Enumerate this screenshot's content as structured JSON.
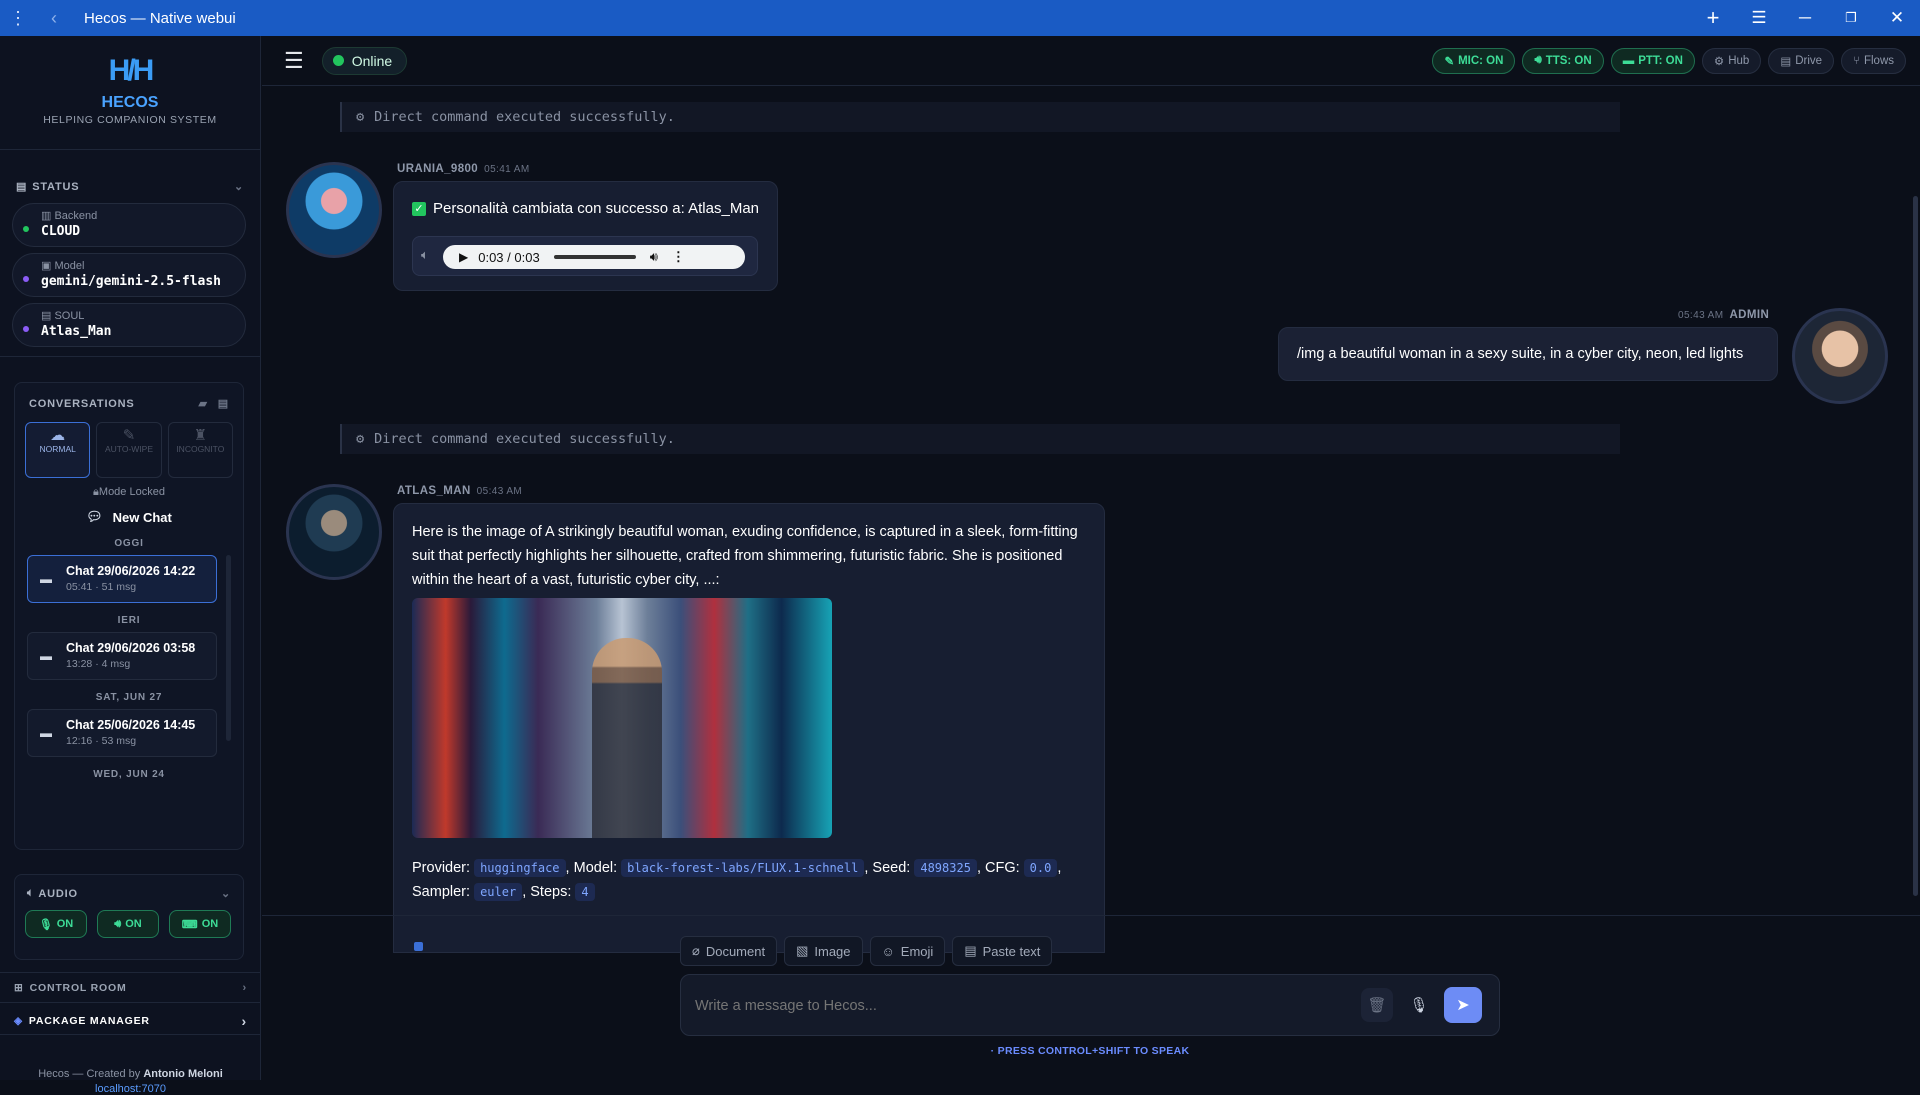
{
  "window": {
    "title": "Hecos — Native webui"
  },
  "brand": {
    "name": "HECOS",
    "subtitle": "HELPING COMPANION SYSTEM"
  },
  "status": {
    "heading": "STATUS",
    "items": [
      {
        "label": "Backend",
        "value": "CLOUD",
        "color": "#22c55e"
      },
      {
        "label": "Model",
        "value": "gemini/gemini-2.5-flash",
        "color": "#8b5cf6"
      },
      {
        "label": "SOUL",
        "value": "Atlas_Man",
        "color": "#8b5cf6"
      }
    ]
  },
  "conversations": {
    "heading": "CONVERSATIONS",
    "modes": [
      {
        "label": "NORMAL",
        "icon": "cloud-icon"
      },
      {
        "label": "AUTO-WIPE",
        "icon": "broom-icon"
      },
      {
        "label": "INCOGNITO",
        "icon": "incognito-icon"
      }
    ],
    "mode_locked": "Mode Locked",
    "new_chat": "New Chat",
    "groups": [
      {
        "day": "OGGI",
        "chats": [
          {
            "title": "Chat 29/06/2026 14:22",
            "sub": "05:41 · 51 msg"
          }
        ]
      },
      {
        "day": "IERI",
        "chats": [
          {
            "title": "Chat 29/06/2026 03:58",
            "sub": "13:28 · 4 msg"
          }
        ]
      },
      {
        "day": "SAT, JUN 27",
        "chats": [
          {
            "title": "Chat 25/06/2026 14:45",
            "sub": "12:16 · 53 msg"
          }
        ]
      },
      {
        "day": "WED, JUN 24",
        "chats": []
      }
    ]
  },
  "audio": {
    "heading": "AUDIO",
    "mic": "ON",
    "tts": "ON",
    "ptt": "ON"
  },
  "nav": {
    "control_room": "CONTROL ROOM",
    "package_manager": "PACKAGE MANAGER"
  },
  "footer": {
    "text": "Hecos — Created by",
    "author": "Antonio Meloni",
    "host": "localhost:7070"
  },
  "topbar": {
    "online": "Online",
    "pills": [
      "MIC: ON",
      "TTS: ON",
      "PTT: ON",
      "Hub",
      "Drive",
      "Flows"
    ]
  },
  "messages": {
    "sys1": "Direct command executed successfully.",
    "sys2": "Direct command executed successfully.",
    "m1": {
      "sender": "URANIA_9800",
      "time": "05:41 AM",
      "text": "Personalità cambiata con successo a: Atlas_Man",
      "audio_time": "0:03 / 0:03"
    },
    "m2": {
      "sender": "ADMIN",
      "time": "05:43 AM",
      "text": "/img a beautiful woman in a sexy suite, in a cyber city, neon, led lights"
    },
    "m3": {
      "sender": "ATLAS_MAN",
      "time": "05:43 AM",
      "text": "Here is the image of A strikingly beautiful woman, exuding confidence, is captured in a sleek, form-fitting suit that perfectly highlights her silhouette, crafted from shimmering, futuristic fabric. She is positioned within the heart of a vast, futuristic cyber city, ...:",
      "provider_label": "Provider:",
      "provider": "huggingface",
      "model_label": "Model:",
      "model": "black-forest-labs/FLUX.1-schnell",
      "seed_label": "Seed:",
      "seed": "4898325",
      "cfg_label": "CFG:",
      "cfg": "0.0",
      "sampler_label": "Sampler:",
      "sampler": "euler",
      "steps_label": "Steps:",
      "steps": "4"
    }
  },
  "composer": {
    "tools": [
      "Document",
      "Image",
      "Emoji",
      "Paste text"
    ],
    "placeholder": "Write a message to Hecos...",
    "hint": "· PRESS CONTROL+SHIFT TO SPEAK"
  }
}
